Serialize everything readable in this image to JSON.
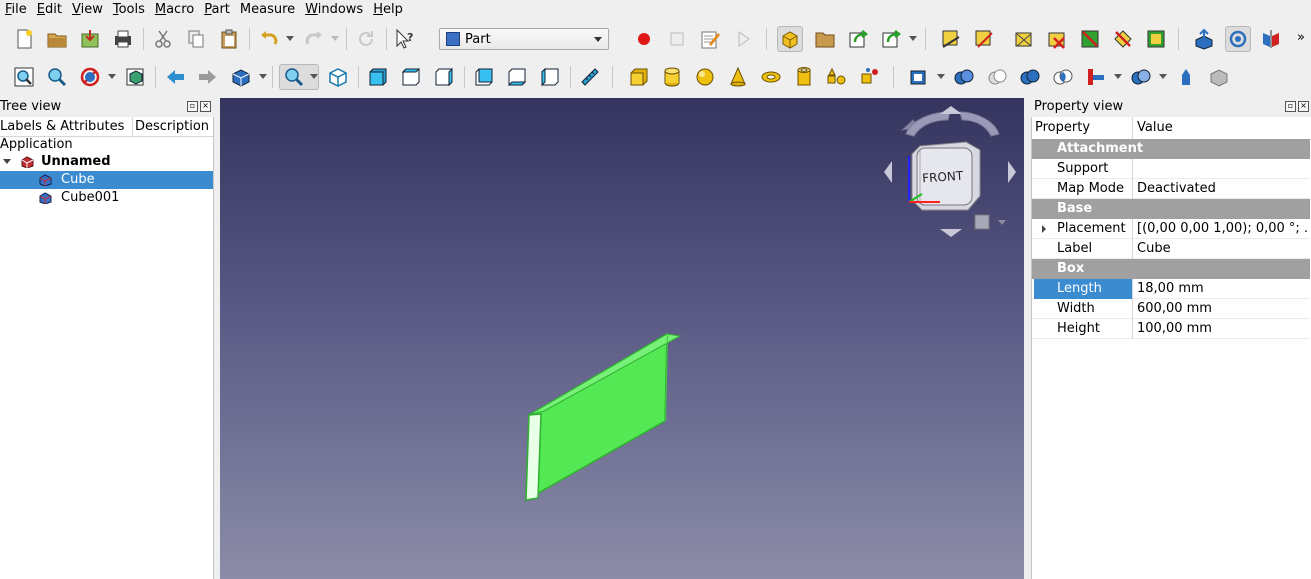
{
  "menu": [
    {
      "label": "File",
      "key": "F",
      "rest": "ile"
    },
    {
      "label": "Edit",
      "key": "E",
      "rest": "dit"
    },
    {
      "label": "View",
      "key": "V",
      "rest": "iew"
    },
    {
      "label": "Tools",
      "key": "T",
      "rest": "ools"
    },
    {
      "label": "Macro",
      "key": "M",
      "rest": "acro"
    },
    {
      "label": "Part",
      "key": "P",
      "rest": "art"
    },
    {
      "label": "Measure",
      "key": "",
      "rest": "Measure"
    },
    {
      "label": "Windows",
      "key": "W",
      "rest": "indows"
    },
    {
      "label": "Help",
      "key": "H",
      "rest": "elp"
    }
  ],
  "toolbar": {
    "workbench": "Part",
    "more": "»"
  },
  "navcube": {
    "face": "FRONT"
  },
  "tree_panel": {
    "title": "Tree view",
    "col_labels": "Labels & Attributes",
    "col_description": "Description",
    "application": "Application",
    "document": "Unnamed",
    "items": [
      {
        "label": "Cube",
        "selected": true
      },
      {
        "label": "Cube001",
        "selected": false
      }
    ]
  },
  "property_panel": {
    "title": "Property view",
    "col_property": "Property",
    "col_value": "Value",
    "groups": [
      {
        "name": "Attachment",
        "rows": [
          {
            "name": "Support",
            "value": ""
          },
          {
            "name": "Map Mode",
            "value": "Deactivated"
          }
        ]
      },
      {
        "name": "Base",
        "rows": [
          {
            "name": "Placement",
            "value": "[(0,00 0,00 1,00); 0,00 °; ..."
          },
          {
            "name": "Label",
            "value": "Cube"
          }
        ]
      },
      {
        "name": "Box",
        "rows": [
          {
            "name": "Length",
            "value": "18,00 mm"
          },
          {
            "name": "Width",
            "value": "600,00 mm"
          },
          {
            "name": "Height",
            "value": "100,00 mm"
          }
        ]
      }
    ]
  },
  "colors": {
    "selection": "#3a8bd0",
    "shape_highlight": "#55e855",
    "group_header": "#a0a0a0"
  }
}
